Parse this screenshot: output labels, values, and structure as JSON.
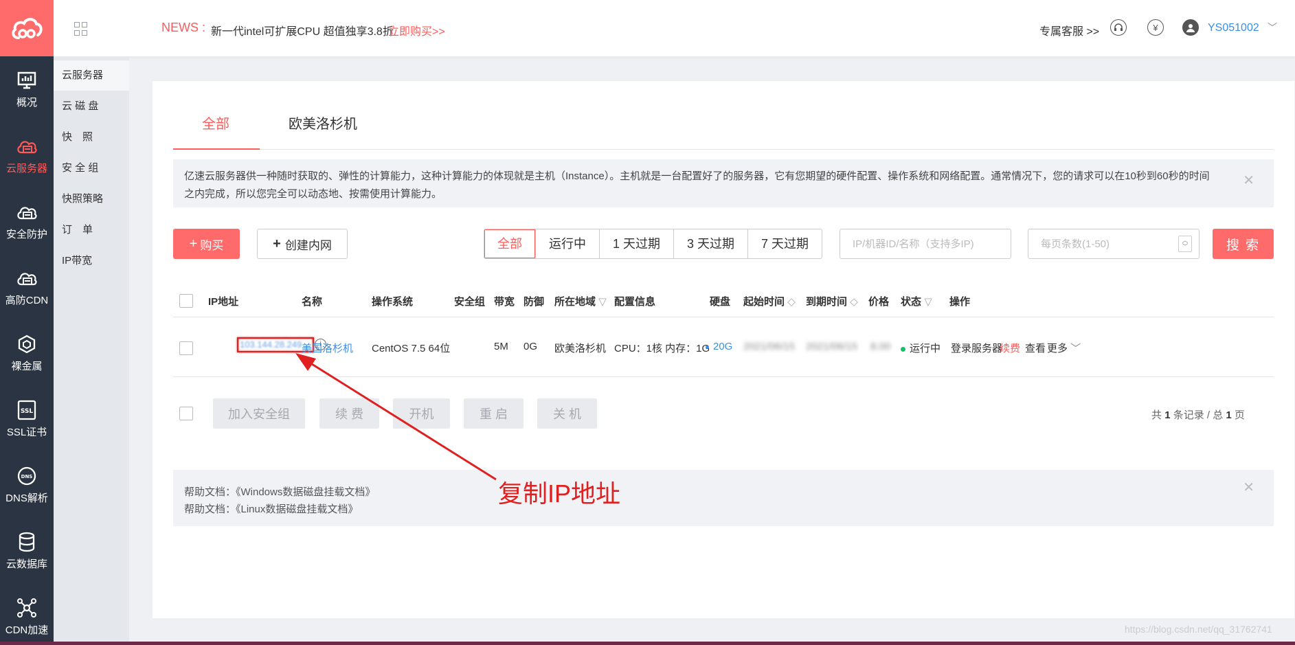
{
  "header": {
    "news_label": "NEWS :",
    "news_text": "新一代intel可扩展CPU 超值独享3.8折",
    "news_link": "立即购买>>",
    "support": "专属客服 >>",
    "currency_icon": "¥",
    "username": "YS051002"
  },
  "nav": {
    "items": [
      {
        "label": "概况",
        "icon": "monitor-icon"
      },
      {
        "label": "云服务器",
        "icon": "cloud-server-icon"
      },
      {
        "label": "安全防护",
        "icon": "security-icon"
      },
      {
        "label": "高防CDN",
        "icon": "cdn-icon"
      },
      {
        "label": "裸金属",
        "icon": "bare-metal-icon"
      },
      {
        "label": "SSL证书",
        "icon": "ssl-icon"
      },
      {
        "label": "DNS解析",
        "icon": "dns-icon"
      },
      {
        "label": "云数据库",
        "icon": "database-icon"
      },
      {
        "label": "CDN加速",
        "icon": "cdn-accel-icon"
      }
    ],
    "ssl_badge": "SSL",
    "dns_badge": "DNS"
  },
  "subnav": {
    "items": [
      "云服务器",
      "云 磁 盘",
      "快　照",
      "安 全 组",
      "快照策略",
      "订　单",
      "IP带宽"
    ]
  },
  "tabs": [
    "全部",
    "欧美洛杉机"
  ],
  "notice": "亿速云服务器供一种随时获取的、弹性的计算能力，这种计算能力的体现就是主机（Instance）。主机就是一台配置好了的服务器，它有您期望的硬件配置、操作系统和网络配置。通常情况下，您的请求可以在10秒到60秒的时间之内完成，所以您完全可以动态地、按需使用计算能力。",
  "toolbar": {
    "buy": "购买",
    "create_intranet": "创建内网",
    "filters": [
      "全部",
      "运行中",
      "1 天过期",
      "3 天过期",
      "7 天过期"
    ],
    "search_placeholder": "IP/机器ID/名称（支持多IP)",
    "per_page_placeholder": "每页条数(1-50)",
    "search": "搜 索"
  },
  "table": {
    "headers": [
      "IP地址",
      "名称",
      "操作系统",
      "安全组",
      "带宽",
      "防御",
      "所在地域",
      "配置信息",
      "硬盘",
      "起始时间",
      "到期时间",
      "价格",
      "状态",
      "操作"
    ],
    "row": {
      "ip": "103.144.28.249",
      "name": "美国洛杉机",
      "os": "CentOS 7.5 64位",
      "bandwidth": "5M",
      "defense": "0G",
      "region": "欧美洛杉机",
      "config": "CPU：1核 内存：1G",
      "disk": "20G",
      "start": "2021/06/15",
      "end": "2021/06/15",
      "price": "8.00",
      "status": "运行中",
      "actions": {
        "login": "登录服务器",
        "renew": "续费",
        "view": "查看",
        "more": "更多"
      }
    }
  },
  "bulk_actions": [
    "加入安全组",
    "续 费",
    "开机",
    "重 启",
    "关 机"
  ],
  "pager": {
    "prefix": "共",
    "records": "1",
    "mid": "条记录 / 总",
    "pages": "1",
    "suffix": "页"
  },
  "help": {
    "line1": "帮助文档：《Windows数据磁盘挂载文档》",
    "line2": "帮助文档：《Linux数据磁盘挂载文档》"
  },
  "annotation": "复制IP地址",
  "watermark": "https://blog.csdn.net/qq_31762741",
  "colors": {
    "accent": "#ff5a5a",
    "nav_bg": "#2b3442",
    "link": "#3a8ee6",
    "annotation": "#e02020"
  }
}
